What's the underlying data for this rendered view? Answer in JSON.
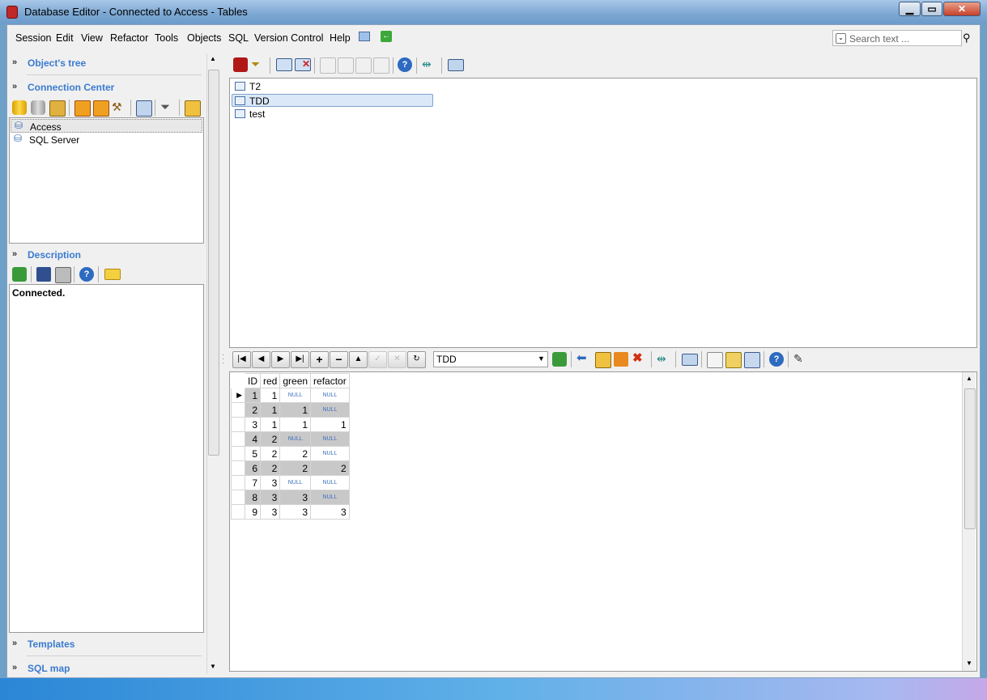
{
  "window": {
    "title": "Database Editor - Connected to Access - Tables",
    "minimize": "▁",
    "maximize": "▭",
    "close": "✕"
  },
  "menu": [
    "Session",
    "Edit",
    "View",
    "Refactor",
    "Tools",
    "Objects",
    "SQL",
    "Version Control",
    "Help"
  ],
  "search": {
    "placeholder": "Search text ..."
  },
  "left": {
    "objects_tree": "Object's tree",
    "connection_center": "Connection Center",
    "connections": [
      "Access",
      "SQL Server"
    ],
    "description": "Description",
    "description_text": "Connected.",
    "templates": "Templates",
    "sql_map": "SQL map"
  },
  "tables": [
    "T2",
    "TDD",
    "test"
  ],
  "selected_table": "TDD",
  "grid": {
    "table_select": "TDD",
    "columns": [
      "ID",
      "red",
      "green",
      "refactor"
    ],
    "rows": [
      [
        "1",
        "1",
        "NULL",
        "NULL"
      ],
      [
        "2",
        "1",
        "1",
        "NULL"
      ],
      [
        "3",
        "1",
        "1",
        "1"
      ],
      [
        "4",
        "2",
        "NULL",
        "NULL"
      ],
      [
        "5",
        "2",
        "2",
        "NULL"
      ],
      [
        "6",
        "2",
        "2",
        "2"
      ],
      [
        "7",
        "3",
        "NULL",
        "NULL"
      ],
      [
        "8",
        "3",
        "3",
        "NULL"
      ],
      [
        "9",
        "3",
        "3",
        "3"
      ]
    ]
  },
  "colors": {
    "accent": "#3a7bd0",
    "titlebar": "#7aa6d2",
    "statusbar": "#2b86d6"
  }
}
